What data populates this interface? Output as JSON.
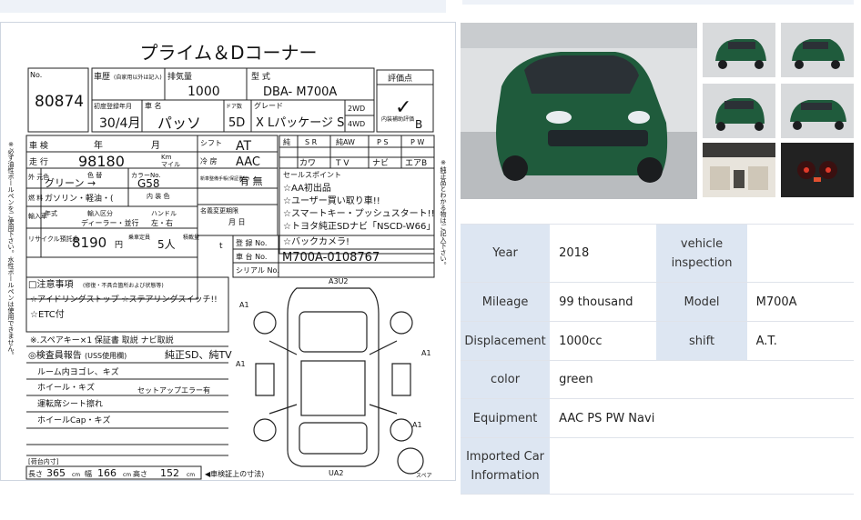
{
  "sheet": {
    "title": "プライム＆Dコーナー",
    "lot_label": "No.",
    "lot_number": "80874",
    "side_note": "※必ず油性ボールペンをご使用下さい。水性ボールペンは使用できません。",
    "right_note": "※純正品とわかる物はご記入下さい。",
    "history_label": "車歴",
    "history_sub": "(自家用以外は記入)",
    "displacement_label": "排気量",
    "displacement_value": "1000",
    "model_label": "型 式",
    "model_value": "DBA- M700A",
    "score_label": "評価点",
    "score_value": "✓",
    "reg_label": "初度登録年月",
    "reg_value": "30/4月",
    "name_label": "車 名",
    "name_value": "パッソ",
    "doors_label": "ドア数",
    "doors_value": "5D",
    "grade_label": "グレード",
    "grade_value": "X Lパッケージ S",
    "drive_2wd": "2WD",
    "drive_4wd": "4WD",
    "interior_label": "内装補助評価",
    "interior_value": "B",
    "inspection_label": "車 検",
    "year_unit": "年",
    "month_unit": "月",
    "shift_label": "シフト",
    "shift_value": "AT",
    "mileage_label": "走 行",
    "mileage_value": "98180",
    "km_label": "Km",
    "mile_label": "マイル",
    "aircon_label": "冷 房",
    "aircon_value": "AAC",
    "ext_color_label": "外 元色",
    "ext_color_label2": "色 替",
    "ext_color_value": "グリーン →",
    "color_no_label": "カラーNo.",
    "color_no_value": "G58",
    "fuel_label": "燃 料",
    "fuel_value": "ガソリン・軽油・(",
    "trim_label": "内 装 色",
    "import_label": "輸入車",
    "import_year": "年式",
    "import_period": "輸入区分",
    "import_handle": "ハンドル",
    "dealer_label": "ディーラー・並行",
    "handle_value": "左・右",
    "recycle_label": "リサイクル預託金",
    "recycle_value": "8190",
    "recycle_unit": "円",
    "capacity_label": "乗車定員",
    "capacity_value": "5人",
    "load_label": "積載量",
    "load_unit": "t",
    "newcar_label": "新車整備手帳(保証書付)",
    "newcar_value": "有 無",
    "owner_label": "名義変更期限",
    "owner_unit": "月 日",
    "reg_no_label": "登 録 No.",
    "chassis_label": "車 台 No.",
    "chassis_value": "M700A-0108767",
    "serial_label": "シリアル No.",
    "equip_headers": [
      "純",
      "S R",
      "純AW",
      "P S",
      "P W"
    ],
    "equip_row2": [
      "カワ",
      "T V",
      "ナビ",
      "エアB"
    ],
    "sales_label": "セールスポイント",
    "sales_points": [
      "☆AA初出品",
      "☆ユーザー買い取り車!!",
      "☆スマートキー・プッシュスタート!!",
      "☆トヨタ純正SDナビ「NSCD-W66」",
      "☆バックカメラ!"
    ],
    "notes_label": "□注意事項",
    "notes_sub": "(修復・不具合箇所および状態等)",
    "notes_lines": [
      "☆アイドリングストップ ☆ステアリングスイッチ!!",
      "☆ETC付"
    ],
    "notes_bottom": "※.スペアキー×1 保証書 取説 ナビ取説",
    "inspector_label": "◎検査員報告",
    "inspector_sub": "(USS使用欄)",
    "inspector_title": "純正SD、純TV",
    "inspector_lines": [
      "ルーム内ヨゴレ、キズ",
      "ホイール・キズ",
      "運転席シート擦れ",
      "ホイールCap・キズ"
    ],
    "inspector_side": "セットアップエラー有",
    "cargo_label": "[荷台内寸]",
    "dims_label": "長さ",
    "dims_length": "365",
    "dims_width_label": "幅",
    "dims_width": "166",
    "dims_height_label": "高さ",
    "dims_height": "152",
    "dims_unit": "cm",
    "dims_note": "◀車検証上の寸法)",
    "diagram_marks": [
      "A3U2",
      "A1",
      "A1",
      "A1",
      "A1",
      "UA2"
    ],
    "spare_label": "スペア"
  },
  "specs": [
    {
      "label": "Year",
      "value": "2018",
      "label2": "vehicle inspection",
      "value2": ""
    },
    {
      "label": "Mileage",
      "value": "99 thousand",
      "label2": "Model",
      "value2": "M700A"
    },
    {
      "label": "Displacement",
      "value": "1000cc",
      "label2": "shift",
      "value2": "A.T."
    },
    {
      "label": "color",
      "value": "green"
    },
    {
      "label": "Equipment",
      "value": "AAC PS PW Navi"
    },
    {
      "label": "Imported Car Information",
      "value": ""
    }
  ],
  "colors": {
    "car_body": "#1f5b3c",
    "label_bg": "#dde6f2"
  }
}
